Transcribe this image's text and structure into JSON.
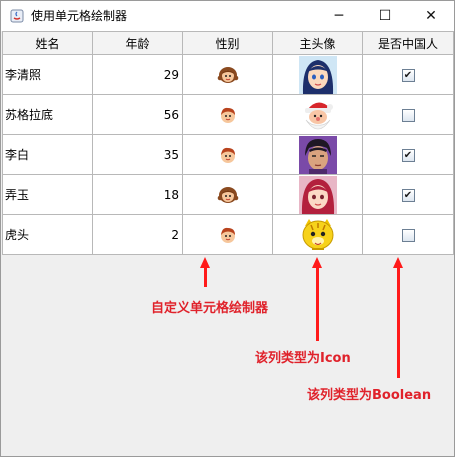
{
  "window": {
    "title": "使用单元格绘制器",
    "controls": {
      "minimize": "─",
      "maximize": "☐",
      "close": "✕"
    }
  },
  "table": {
    "columns": [
      "姓名",
      "年龄",
      "性别",
      "主头像",
      "是否中国人"
    ],
    "rows": [
      {
        "name": "李清照",
        "age": "29",
        "gender_icon": "girl-face-icon",
        "avatar_icon": "blue-hair-girl-avatar",
        "chinese": true,
        "chinese_mark": "✔"
      },
      {
        "name": "苏格拉底",
        "age": "56",
        "gender_icon": "boy-face-icon",
        "avatar_icon": "santa-avatar",
        "chinese": false,
        "chinese_mark": ""
      },
      {
        "name": "李白",
        "age": "35",
        "gender_icon": "boy-face-icon",
        "avatar_icon": "man-avatar",
        "chinese": true,
        "chinese_mark": "✔"
      },
      {
        "name": "弄玉",
        "age": "18",
        "gender_icon": "girl-face-icon",
        "avatar_icon": "red-hair-girl-avatar",
        "chinese": true,
        "chinese_mark": "✔"
      },
      {
        "name": "虎头",
        "age": "2",
        "gender_icon": "boy-face-icon",
        "avatar_icon": "tiger-avatar",
        "chinese": false,
        "chinese_mark": ""
      }
    ]
  },
  "annotations": {
    "renderer": "自定义单元格绘制器",
    "icon_type": "该列类型为Icon",
    "boolean_type": "该列类型为Boolean",
    "color": "#e0222b"
  }
}
